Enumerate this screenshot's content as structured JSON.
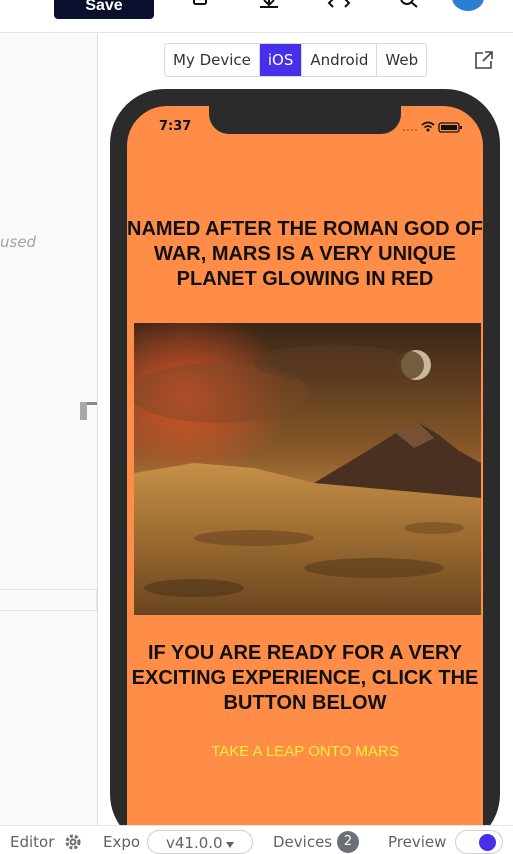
{
  "toolbar": {
    "save_label": "Save",
    "icons": [
      "device-icon",
      "download-icon",
      "code-icon",
      "search-icon"
    ]
  },
  "left_pane": {
    "partial_text": "used"
  },
  "preview": {
    "platform_tabs": [
      "My Device",
      "iOS",
      "Android",
      "Web"
    ],
    "active_tab": "iOS",
    "accent_color": "#4630eb"
  },
  "device": {
    "time": "7:37",
    "background_color": "#ff8c47",
    "headline": "NAMED AFTER THE ROMAN GOD OF WAR, MARS IS A VERY UNIQUE PLANET GLOWING IN RED",
    "cta_text": "IF YOU ARE READY FOR A VERY EXCITING EXPERIENCE, CLICK THE BUTTON BELOW",
    "link_text": "TAKE A LEAP ONTO MARS",
    "link_color": "#f7f13a"
  },
  "footer": {
    "editor_label": "Editor",
    "expo_label": "Expo",
    "version": "v41.0.0",
    "devices_label": "Devices",
    "devices_count": "2",
    "preview_label": "Preview"
  }
}
